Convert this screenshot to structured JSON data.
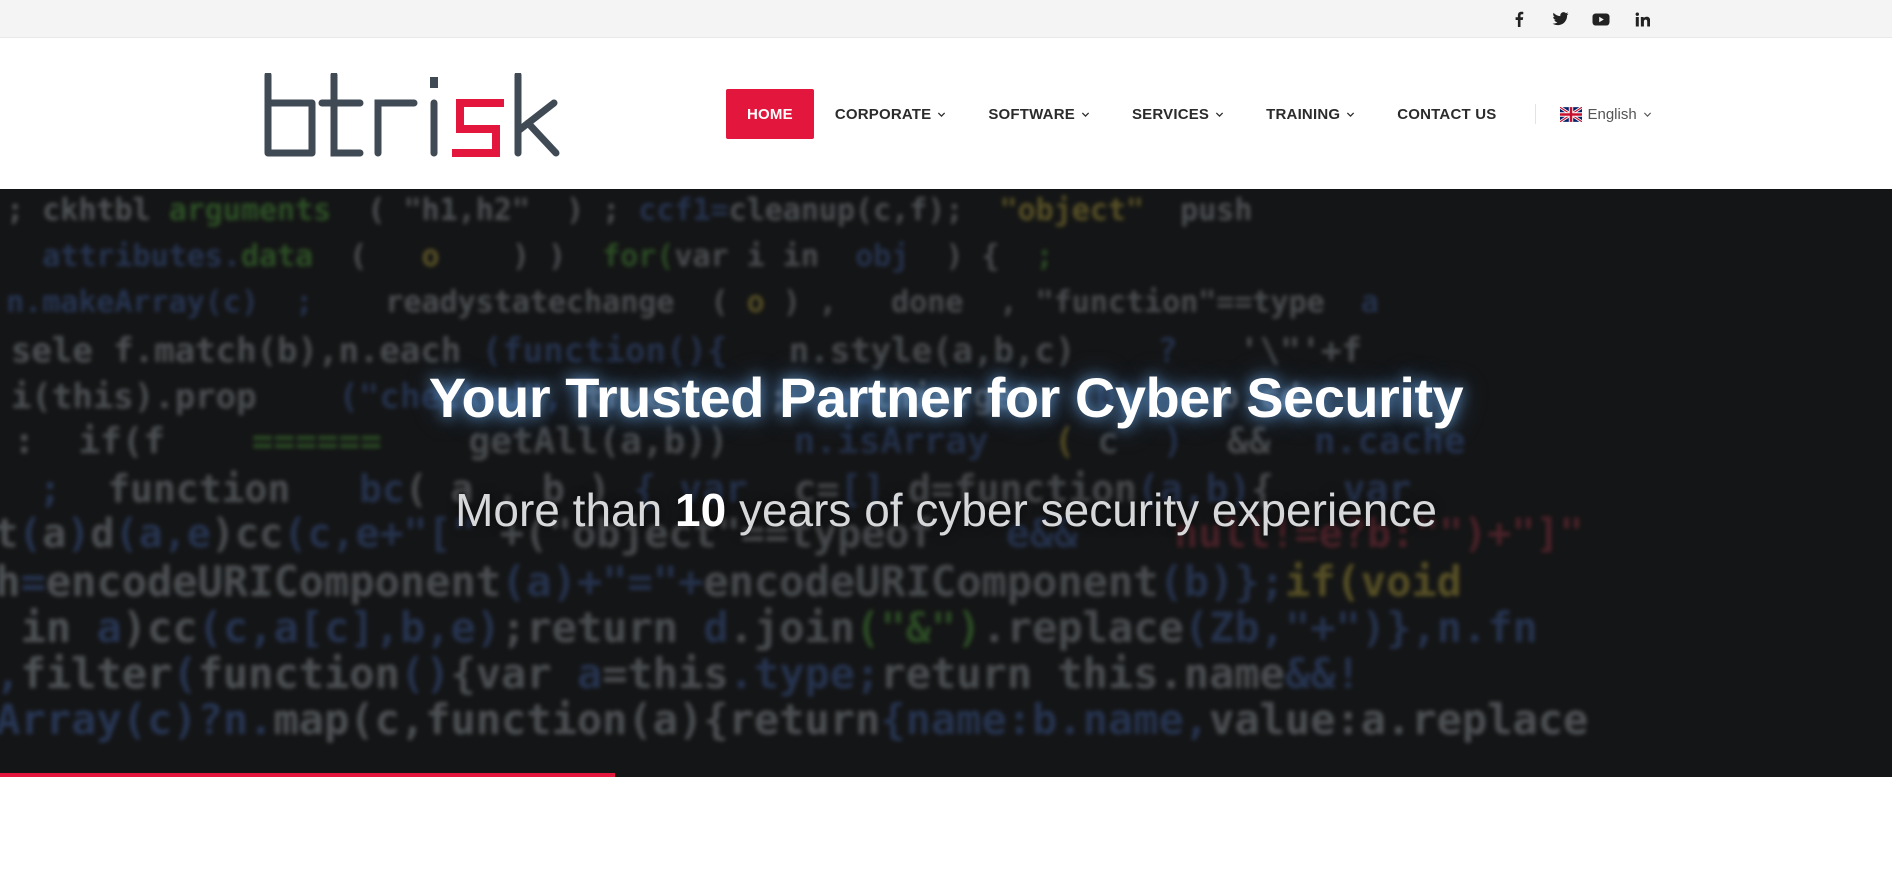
{
  "social": {
    "icons": [
      "facebook-icon",
      "twitter-icon",
      "youtube-icon",
      "linkedin-icon"
    ]
  },
  "logo": {
    "text": "btrisk",
    "colors": {
      "dark": "#3f4a55",
      "accent": "#e3173e"
    }
  },
  "nav": {
    "items": [
      {
        "label": "HOME",
        "active": true,
        "dropdown": false
      },
      {
        "label": "CORPORATE",
        "dropdown": true
      },
      {
        "label": "SOFTWARE",
        "dropdown": true
      },
      {
        "label": "SERVICES",
        "dropdown": true
      },
      {
        "label": "TRAINING",
        "dropdown": true
      },
      {
        "label": "CONTACT US",
        "dropdown": false
      }
    ],
    "language": {
      "label": "English",
      "flag": "uk-flag-icon"
    }
  },
  "hero": {
    "title": "Your Trusted Partner for Cyber Security",
    "subtitle_prefix": "More than",
    "subtitle_number": "10",
    "subtitle_suffix": "years of cyber security experience",
    "slider_progress": 0.325
  },
  "colors": {
    "accent": "#e3173e",
    "topbar_bg": "#f4f4f4",
    "hero_bg": "#141516"
  }
}
